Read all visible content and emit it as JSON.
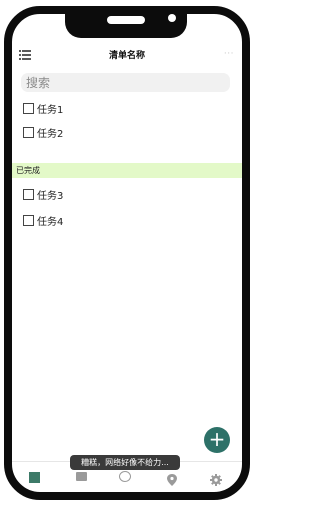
{
  "header": {
    "title": "清单名称",
    "more": "···"
  },
  "search": {
    "placeholder": "搜索"
  },
  "tasks": [
    {
      "label": "任务1"
    },
    {
      "label": "任务2"
    }
  ],
  "done_section": {
    "label": "已完成",
    "tasks": [
      {
        "label": "任务3"
      },
      {
        "label": "任务4"
      }
    ]
  },
  "fab": {
    "label": "+"
  },
  "toast": {
    "message": "糟糕，网络好像不给力..."
  },
  "tabs": [
    {
      "icon": "home-icon",
      "active": true
    },
    {
      "icon": "calendar-icon"
    },
    {
      "icon": "face-icon"
    },
    {
      "icon": "location-pin-icon"
    },
    {
      "icon": "gear-icon"
    }
  ],
  "colors": {
    "accent": "#2d7168",
    "done_header_bg": "#e3f9c8",
    "toast_bg": "#3a3a3a"
  }
}
